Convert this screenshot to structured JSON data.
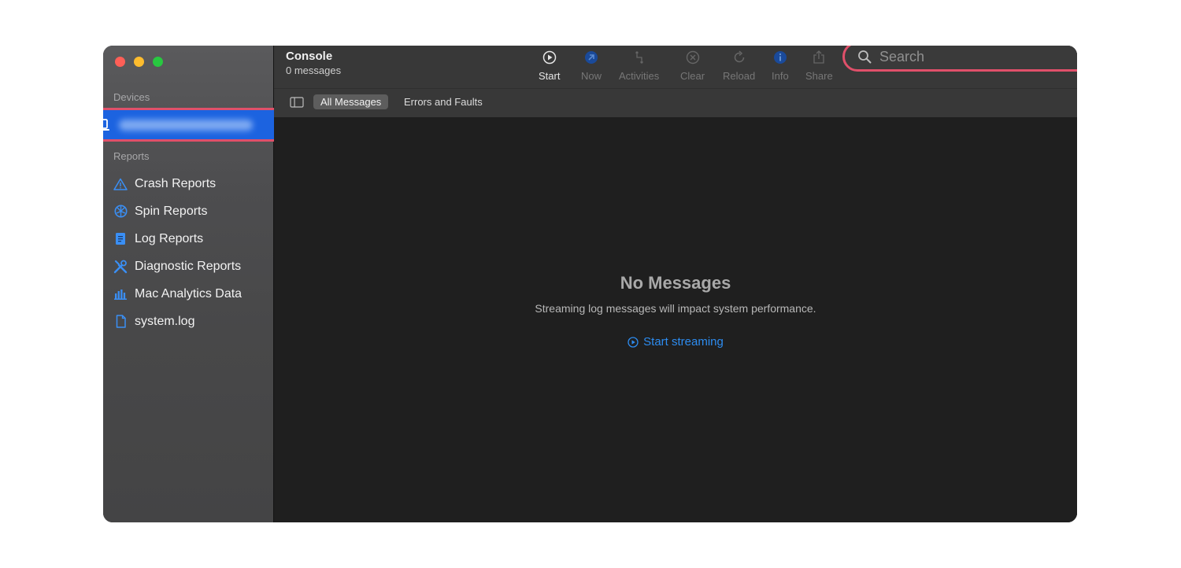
{
  "window": {
    "title": "Console",
    "subtitle": "0 messages"
  },
  "sidebar": {
    "devices_label": "Devices",
    "reports_label": "Reports",
    "items": [
      {
        "label": "Crash Reports",
        "icon": "warning-triangle-icon"
      },
      {
        "label": "Spin Reports",
        "icon": "spin-wheel-icon"
      },
      {
        "label": "Log Reports",
        "icon": "log-document-icon"
      },
      {
        "label": "Diagnostic Reports",
        "icon": "tools-icon"
      },
      {
        "label": "Mac Analytics Data",
        "icon": "bar-chart-icon"
      },
      {
        "label": "system.log",
        "icon": "file-icon"
      }
    ]
  },
  "toolbar": {
    "start": "Start",
    "now": "Now",
    "activities": "Activities",
    "clear": "Clear",
    "reload": "Reload",
    "info": "Info",
    "share": "Share"
  },
  "search": {
    "placeholder": "Search"
  },
  "filters": {
    "all": "All Messages",
    "errors": "Errors and Faults"
  },
  "empty_state": {
    "title": "No Messages",
    "subtitle": "Streaming log messages will impact system performance.",
    "action": "Start streaming"
  },
  "colors": {
    "accent": "#2d8cf0",
    "selection": "#1c63e0",
    "highlight_ring": "#e0506a"
  }
}
